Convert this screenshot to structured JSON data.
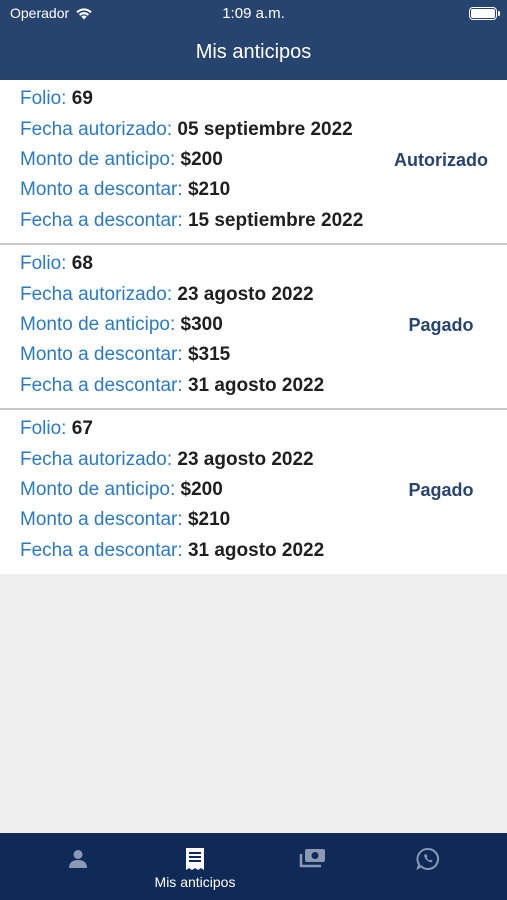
{
  "status_bar": {
    "carrier": "Operador",
    "time": "1:09 a.m."
  },
  "header": {
    "title": "Mis anticipos"
  },
  "labels": {
    "folio": "Folio:",
    "fecha_autorizado": "Fecha autorizado:",
    "monto_anticipo": "Monto de anticipo:",
    "monto_descontar": "Monto a descontar:",
    "fecha_descontar": "Fecha a descontar:"
  },
  "anticipos": [
    {
      "folio": "69",
      "fecha_autorizado": "05 septiembre 2022",
      "monto_anticipo": "$200",
      "monto_descontar": "$210",
      "fecha_descontar": "15 septiembre 2022",
      "estado": "Autorizado"
    },
    {
      "folio": "68",
      "fecha_autorizado": "23 agosto 2022",
      "monto_anticipo": "$300",
      "monto_descontar": "$315",
      "fecha_descontar": "31 agosto 2022",
      "estado": "Pagado"
    },
    {
      "folio": "67",
      "fecha_autorizado": "23 agosto 2022",
      "monto_anticipo": "$200",
      "monto_descontar": "$210",
      "fecha_descontar": "31 agosto 2022",
      "estado": "Pagado"
    }
  ],
  "tabbar": {
    "tabs": [
      {
        "icon": "person-icon",
        "label": ""
      },
      {
        "icon": "document-list-icon",
        "label": "Mis anticipos"
      },
      {
        "icon": "cash-icon",
        "label": ""
      },
      {
        "icon": "whatsapp-icon",
        "label": ""
      }
    ],
    "active_color": "#ffffff",
    "inactive_color": "#8a9ab5"
  }
}
